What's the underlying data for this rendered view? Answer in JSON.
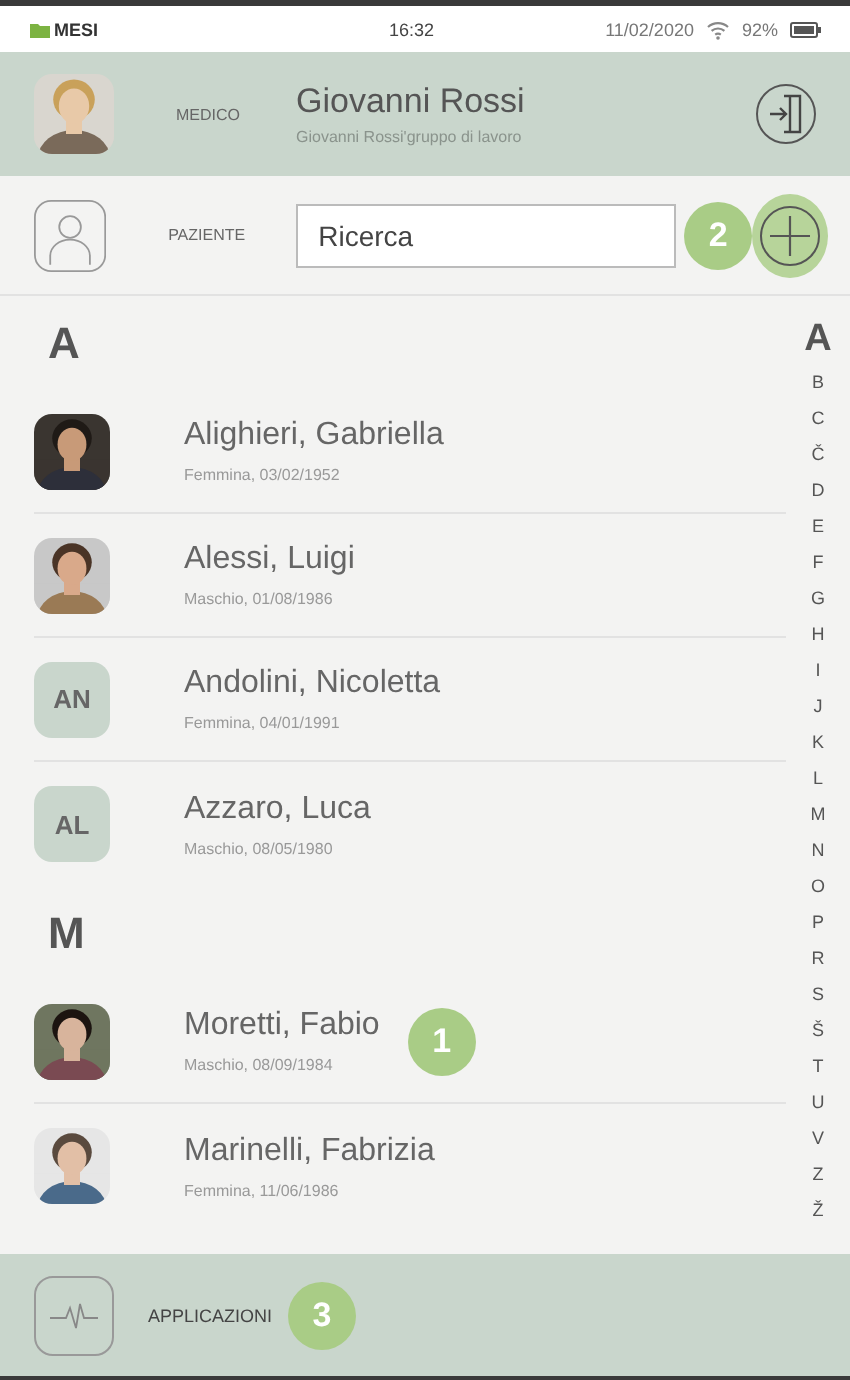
{
  "status_bar": {
    "carrier": "MESI",
    "time": "16:32",
    "date": "11/02/2020",
    "battery": "92%"
  },
  "header": {
    "role": "MEDICO",
    "name": "Giovanni Rossi",
    "group": "Giovanni Rossi'gruppo di lavoro"
  },
  "patient_bar": {
    "label": "PAZIENTE",
    "search": {
      "placeholder": "Ricerca"
    },
    "marker": "2"
  },
  "sections": [
    {
      "letter": "A",
      "patients": [
        {
          "name": "Alighieri, Gabriella",
          "details": "Femmina, 03/02/1952"
        },
        {
          "name": "Alessi, Luigi",
          "details": "Maschio, 01/08/1986"
        },
        {
          "kind": "initials",
          "initials": "AN",
          "name": "Andolini, Nicoletta",
          "details": "Femmina, 04/01/1991"
        },
        {
          "kind": "initials",
          "initials": "AL",
          "name": "Azzaro, Luca",
          "details": "Maschio, 08/05/1980"
        }
      ]
    },
    {
      "letter": "M",
      "patients": [
        {
          "name": "Moretti, Fabio",
          "details": "Maschio, 08/09/1984",
          "marker": "1"
        },
        {
          "name": "Marinelli, Fabrizia",
          "details": "Femmina, 11/06/1986"
        }
      ]
    }
  ],
  "index": [
    {
      "letter": "A",
      "selected": true
    },
    {
      "letter": "B",
      "selected": false
    },
    {
      "letter": "C",
      "selected": false
    },
    {
      "letter": "Č",
      "selected": false
    },
    {
      "letter": "D",
      "selected": false
    },
    {
      "letter": "E",
      "selected": false
    },
    {
      "letter": "F",
      "selected": false
    },
    {
      "letter": "G",
      "selected": false
    },
    {
      "letter": "H",
      "selected": false
    },
    {
      "letter": "I",
      "selected": false
    },
    {
      "letter": "J",
      "selected": false
    },
    {
      "letter": "K",
      "selected": false
    },
    {
      "letter": "L",
      "selected": false
    },
    {
      "letter": "M",
      "selected": false
    },
    {
      "letter": "N",
      "selected": false
    },
    {
      "letter": "O",
      "selected": false
    },
    {
      "letter": "P",
      "selected": false
    },
    {
      "letter": "R",
      "selected": false
    },
    {
      "letter": "S",
      "selected": false
    },
    {
      "letter": "Š",
      "selected": false
    },
    {
      "letter": "T",
      "selected": false
    },
    {
      "letter": "U",
      "selected": false
    },
    {
      "letter": "V",
      "selected": false
    },
    {
      "letter": "Z",
      "selected": false
    },
    {
      "letter": "Ž",
      "selected": false
    }
  ],
  "footer": {
    "label": "APPLICAZIONI",
    "marker": "3"
  }
}
